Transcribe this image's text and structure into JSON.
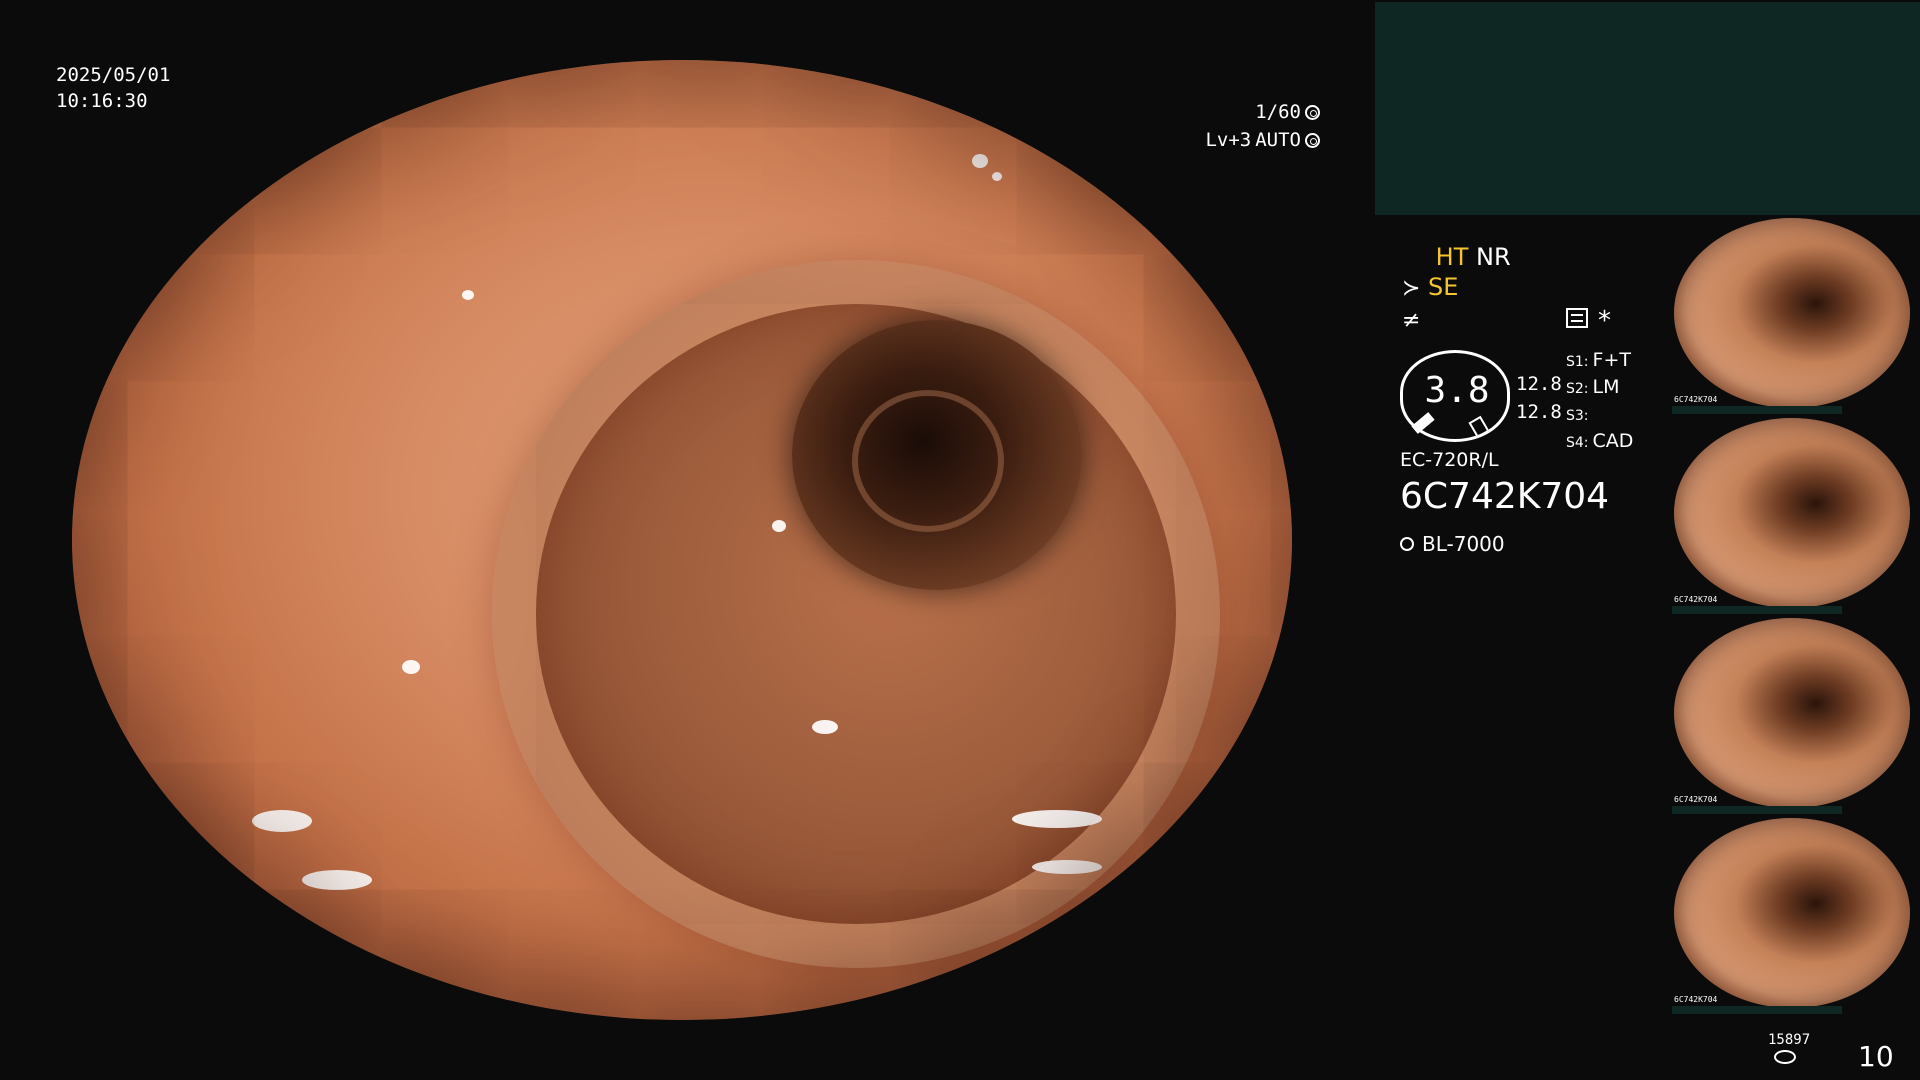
{
  "overlay": {
    "date": "2025/05/01",
    "time": "10:16:30",
    "shutter": "1/60",
    "level": "Lv+3",
    "iris_mode": "AUTO"
  },
  "status": {
    "ht": "HT",
    "nr": "NR",
    "se": "SE",
    "star": "*"
  },
  "gauge": {
    "value": "3.8",
    "line1": "12.8",
    "line2": "12.8"
  },
  "switch_modes": [
    {
      "key": "S1:",
      "value": "F+T"
    },
    {
      "key": "S2:",
      "value": "LM"
    },
    {
      "key": "S3:",
      "value": ""
    },
    {
      "key": "S4:",
      "value": "CAD"
    }
  ],
  "scope": {
    "model": "EC-720R/L",
    "serial": "6C742K704",
    "light_source": "BL-7000"
  },
  "thumbnails": [
    {
      "label": "6C742K704"
    },
    {
      "label": "6C742K704"
    },
    {
      "label": "6C742K704"
    },
    {
      "label": "6C742K704"
    }
  ],
  "footer": {
    "storage": "15897",
    "count": "10"
  },
  "icons": {
    "shutter": "shutter-icon",
    "iris": "iris-icon",
    "light": "lamp-icon",
    "storage": "disk-icon"
  },
  "colors": {
    "accent_yellow": "#f4c431",
    "panel_green": "#0e2723"
  }
}
